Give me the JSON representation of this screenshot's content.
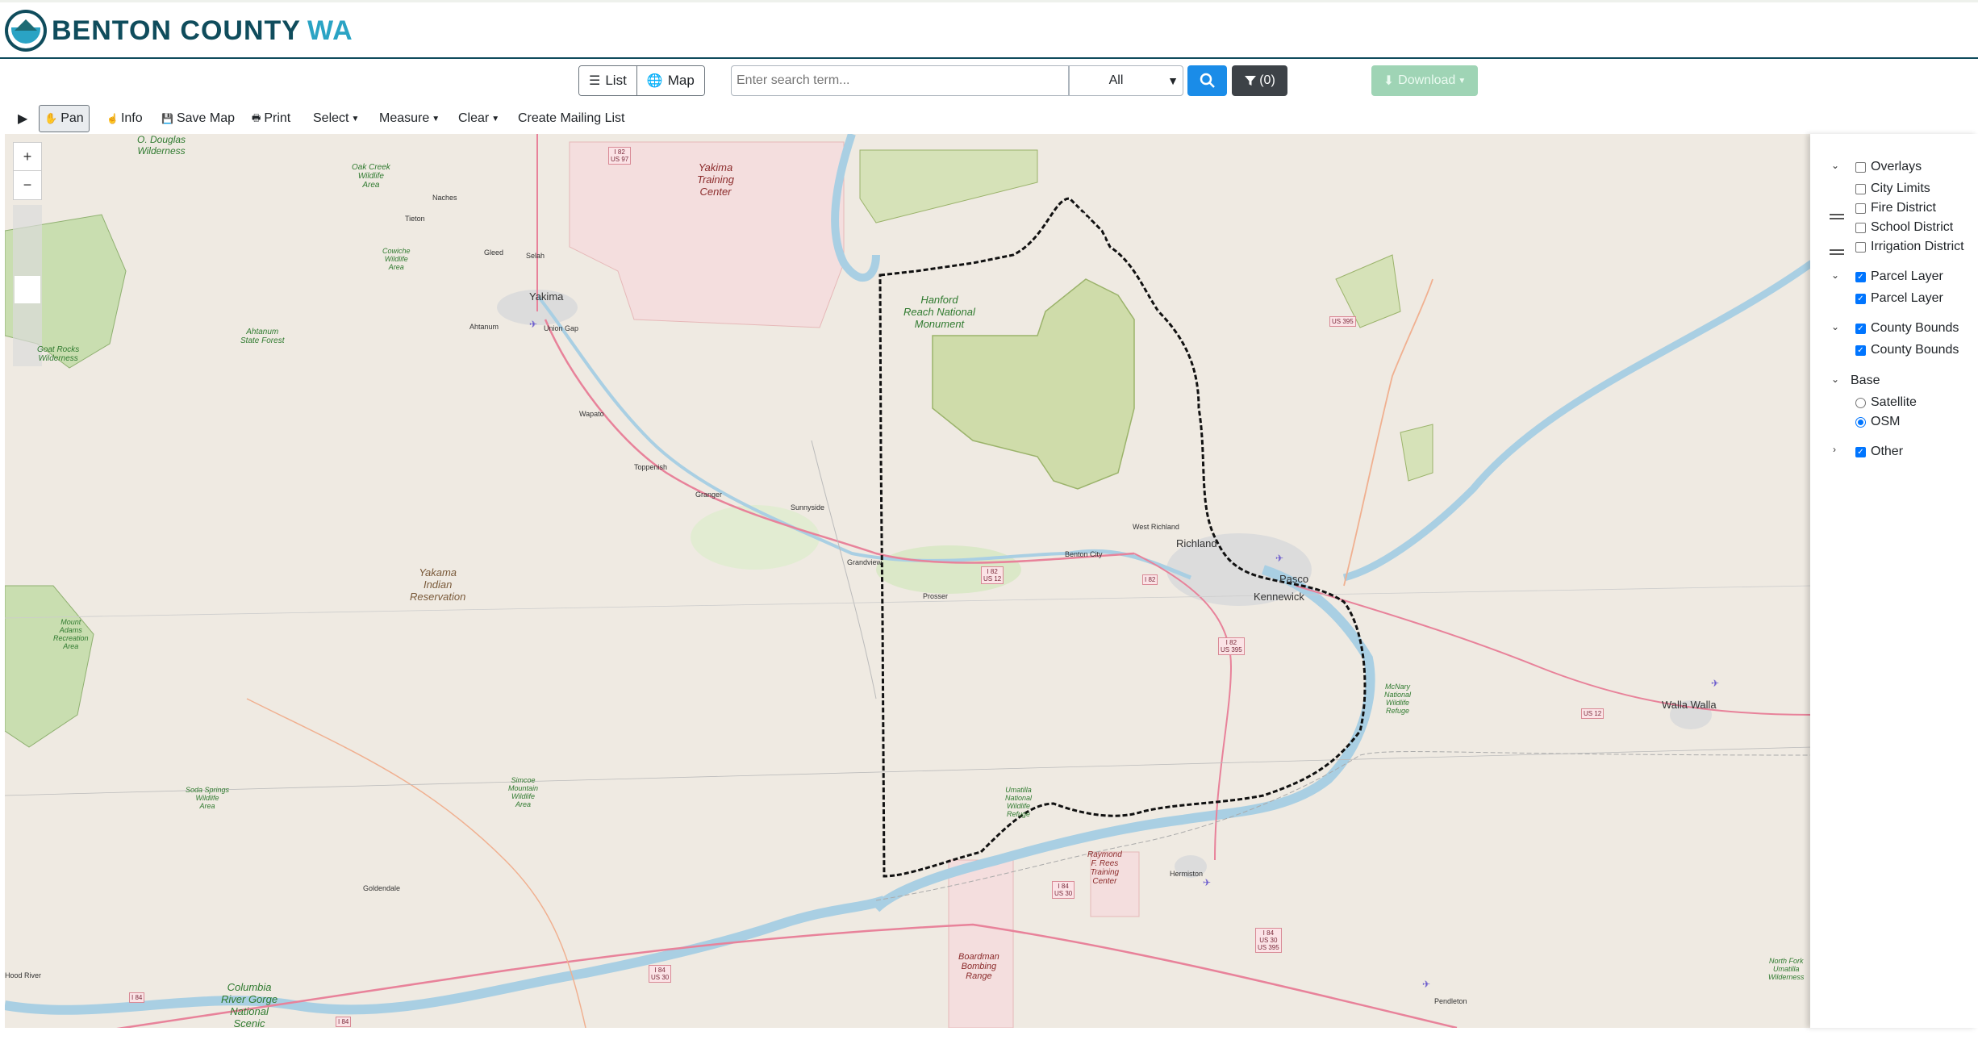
{
  "header": {
    "logo_text_a": "BENTON COUNTY",
    "logo_text_b": "WA"
  },
  "toolbar": {
    "list_label": "List",
    "map_label": "Map",
    "search_placeholder": "Enter search term...",
    "scope_value": "All",
    "filter_count": "(0)",
    "download_label": "Download"
  },
  "maptools": {
    "pan": "Pan",
    "info": "Info",
    "save_map": "Save Map",
    "print": "Print",
    "select": "Select",
    "measure": "Measure",
    "clear": "Clear",
    "mailing": "Create Mailing List"
  },
  "map": {
    "zoom_in": "+",
    "zoom_out": "−",
    "places": {
      "douglas": "O. Douglas\nWilderness",
      "yakima_tc": "Yakima\nTraining\nCenter",
      "oak_creek": "Oak Creek\nWildlife\nArea",
      "naches": "Naches",
      "tieton": "Tieton",
      "gleed": "Gleed",
      "selah": "Selah",
      "cowiche": "Cowiche\nWildlife\nArea",
      "yakima": "Yakima",
      "ahtanum": "Ahtanum",
      "union_gap": "Union Gap",
      "ahtanum_forest": "Ahtanum\nState Forest",
      "goat_rocks": "Goat Rocks\nWilderness",
      "wapato": "Wapato",
      "toppenish": "Toppenish",
      "granger": "Granger",
      "sunnyside": "Sunnyside",
      "grandview": "Grandview",
      "prosser": "Prosser",
      "yakama": "Yakama\nIndian\nReservation",
      "mt_adams": "Mount\nAdams\nRecreation\nArea",
      "hanford": "Hanford\nReach National\nMonument",
      "west_richland": "West Richland",
      "richland": "Richland",
      "benton_city": "Benton City",
      "pasco": "Pasco",
      "kennewick": "Kennewick",
      "mcnary": "McNary\nNational\nWildlife\nRefuge",
      "walla_walla": "Walla Walla",
      "umatilla": "Umatilla\nNational\nWildlife\nRefuge",
      "rees": "Raymond\nF. Rees\nTraining\nCenter",
      "hermiston": "Hermiston",
      "goldendale": "Goldendale",
      "boardman": "Boardman\nBombing\nRange",
      "columbia_gorge": "Columbia\nRiver Gorge\nNational\nScenic",
      "pendleton": "Pendleton",
      "north_fork": "North Fork\nUmatilla\nWilderness",
      "simcoe": "Simcoe\nMountain\nWildlife\nArea",
      "soda_springs": "Soda Springs\nWildlife\nArea",
      "hood_river": "Hood River"
    },
    "shields": {
      "i82_us97": "I 82\nUS 97",
      "us395_n": "US 395",
      "i82_us12": "I 82\nUS 12",
      "i82_a": "I 82",
      "i82_us395": "I 82\nUS 395",
      "us12_e": "US 12",
      "i84_us30_a": "I 84\nUS 30",
      "i84_us30_us395": "I 84\nUS 30\nUS 395",
      "i84_us30_b": "I 84\nUS 30",
      "i84_a": "I 84",
      "i84_b": "I 84"
    }
  },
  "layers": {
    "overlays": "Overlays",
    "city_limits": "City Limits",
    "fire_district": "Fire District",
    "school_district": "School District",
    "irrigation_district": "Irrigation District",
    "parcel_group": "Parcel Layer",
    "parcel_layer": "Parcel Layer",
    "county_group": "County Bounds",
    "county_bounds": "County Bounds",
    "base": "Base",
    "satellite": "Satellite",
    "osm": "OSM",
    "other": "Other"
  }
}
